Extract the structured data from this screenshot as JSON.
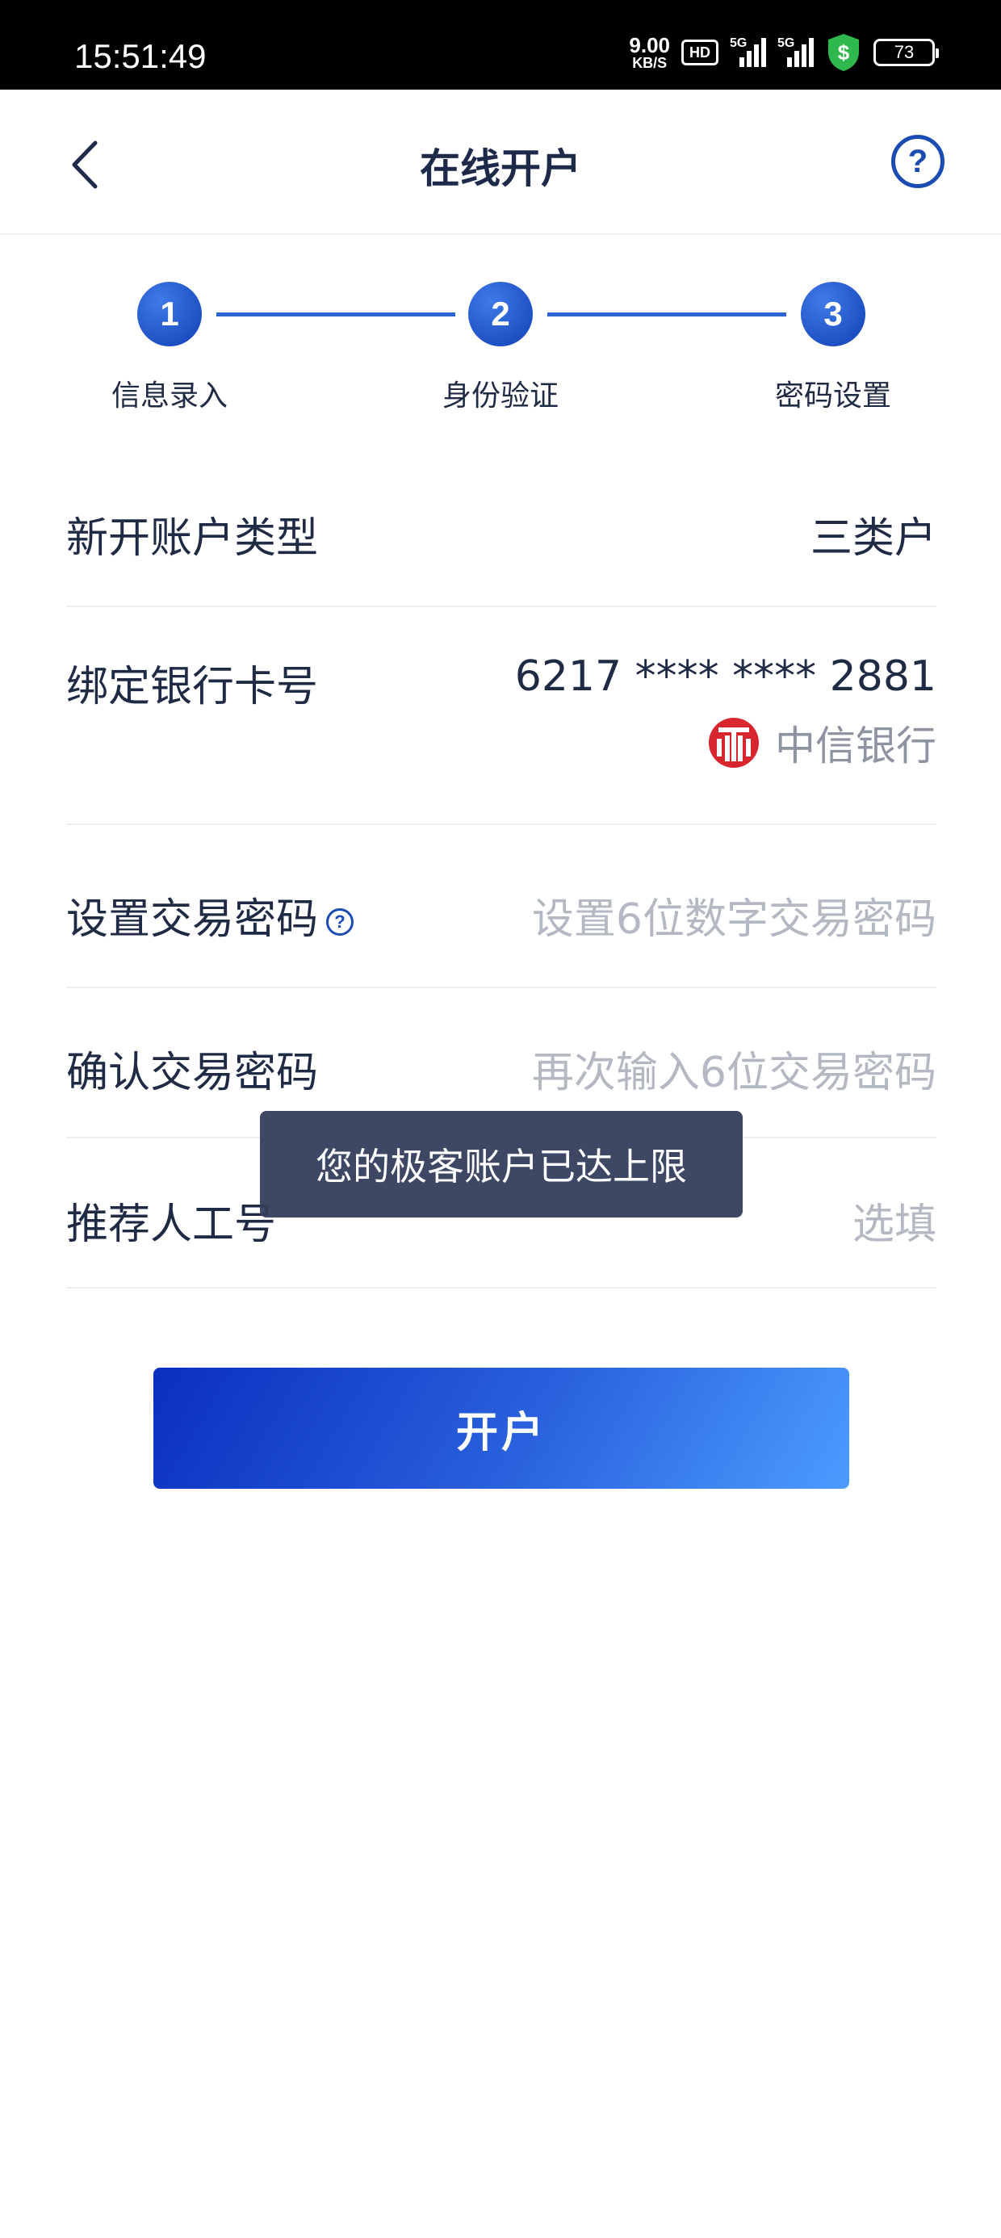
{
  "status_bar": {
    "time": "15:51:49",
    "speed_value": "9.00",
    "speed_unit": "KB/S",
    "hd_label": "HD",
    "signal1_tag": "5G",
    "signal2_tag": "5G",
    "battery": "73",
    "shield_color": "#2fb84e"
  },
  "nav": {
    "title": "在线开户",
    "back_icon": "chevron-left-icon",
    "help_label": "?"
  },
  "stepper": {
    "active_color": "#2d63d2",
    "steps": [
      {
        "number": "1",
        "label": "信息录入"
      },
      {
        "number": "2",
        "label": "身份验证"
      },
      {
        "number": "3",
        "label": "密码设置"
      }
    ]
  },
  "form": {
    "account_type": {
      "label": "新开账户类型",
      "value": "三类户"
    },
    "bank_card": {
      "label": "绑定银行卡号",
      "value": "6217 **** **** 2881",
      "bank_name": "中信银行",
      "bank_color": "#d7262d"
    },
    "trade_password": {
      "label": "设置交易密码",
      "help": "?",
      "placeholder": "设置6位数字交易密码"
    },
    "confirm_password": {
      "label": "确认交易密码",
      "placeholder": "再次输入6位交易密码"
    },
    "referrer": {
      "label": "推荐人工号",
      "placeholder": "选填"
    }
  },
  "submit_button": {
    "label": "开户"
  },
  "toast": {
    "message": "您的极客账户已达上限"
  }
}
